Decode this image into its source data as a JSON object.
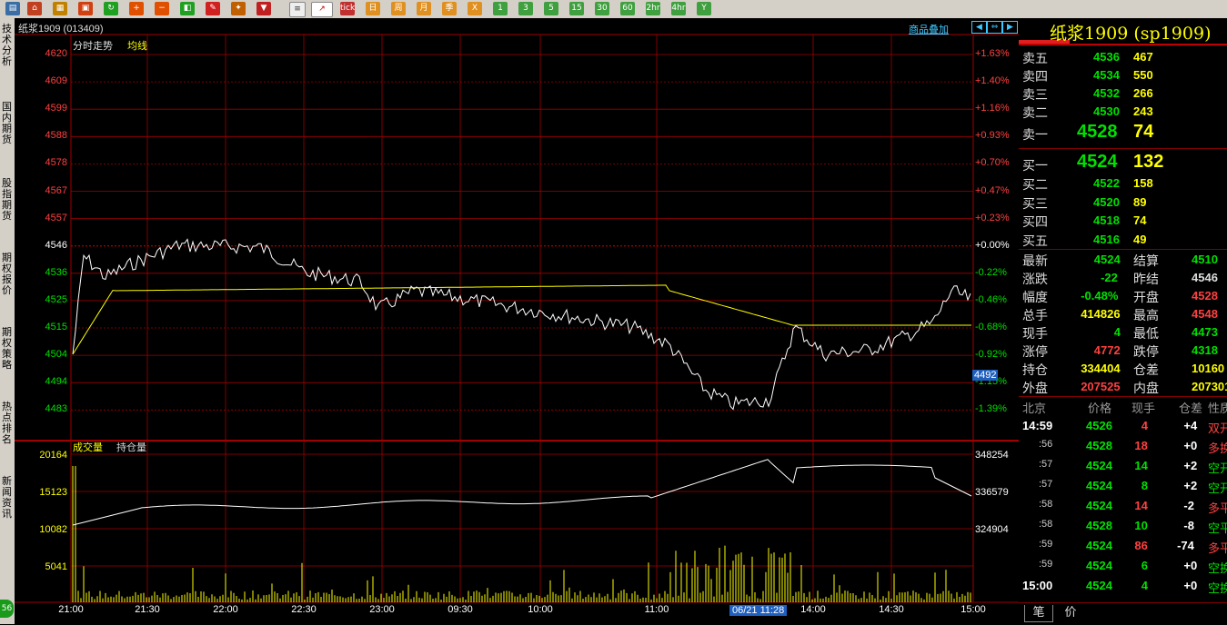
{
  "toolbar": {
    "period_buttons": [
      "tick",
      "日",
      "周",
      "月",
      "季",
      "X",
      "1",
      "3",
      "5",
      "15",
      "30",
      "60",
      "2hr",
      "4hr",
      "Y"
    ]
  },
  "side_tabs": [
    "技术分析",
    "国内期货",
    "股指期货",
    "期权报价",
    "期权策略",
    "热点排名",
    "新闻资讯"
  ],
  "side_bottom": "56",
  "chart": {
    "title": "纸浆1909 (013409)",
    "overlay_button": "商品叠加",
    "legend_price": "分时走势",
    "legend_avg": "均线",
    "price_ticks": [
      "4620",
      "4609",
      "4599",
      "4588",
      "4578",
      "4567",
      "4557",
      "4546",
      "4536",
      "4525",
      "4515",
      "4504",
      "4494",
      "4483"
    ],
    "pct_ticks": [
      "+1.63%",
      "+1.40%",
      "+1.16%",
      "+0.93%",
      "+0.70%",
      "+0.47%",
      "+0.23%",
      "+0.00%",
      "-0.22%",
      "-0.46%",
      "-0.68%",
      "-0.92%",
      "-1.15%",
      "-1.39%"
    ],
    "cursor_price": "4492",
    "volume_title": "成交量",
    "oi_title": "持仓量",
    "vol_ticks": [
      "20164",
      "15123",
      "10082",
      "5041"
    ],
    "oi_ticks": [
      "348254",
      "336579",
      "324904"
    ],
    "time_ticks": [
      "21:00",
      "21:30",
      "22:00",
      "22:30",
      "23:00",
      "09:30",
      "10:00",
      "11:00",
      "14:00",
      "14:30",
      "15:00"
    ],
    "cursor_time": "06/21 11:28",
    "colors": {
      "price_line": "#ffffff",
      "avg_line": "#ffff00",
      "grid": "#a00000",
      "up": "#ff4040",
      "down": "#00e000"
    }
  },
  "quote": {
    "name": "纸浆1909 (sp1909)",
    "sells": [
      {
        "label": "卖五",
        "price": "4536",
        "vol": "467"
      },
      {
        "label": "卖四",
        "price": "4534",
        "vol": "550"
      },
      {
        "label": "卖三",
        "price": "4532",
        "vol": "266"
      },
      {
        "label": "卖二",
        "price": "4530",
        "vol": "243"
      },
      {
        "label": "卖一",
        "price": "4528",
        "vol": "74"
      }
    ],
    "buys": [
      {
        "label": "买一",
        "price": "4524",
        "vol": "132"
      },
      {
        "label": "买二",
        "price": "4522",
        "vol": "158"
      },
      {
        "label": "买三",
        "price": "4520",
        "vol": "89"
      },
      {
        "label": "买四",
        "price": "4518",
        "vol": "74"
      },
      {
        "label": "买五",
        "price": "4516",
        "vol": "49"
      }
    ],
    "stats": [
      {
        "l1": "最新",
        "v1": "4524",
        "l2": "结算",
        "v2": "4510"
      },
      {
        "l1": "涨跌",
        "v1": "-22",
        "l2": "昨结",
        "v2": "4546"
      },
      {
        "l1": "幅度",
        "v1": "-0.48%",
        "l2": "开盘",
        "v2": "4528"
      },
      {
        "l1": "总手",
        "v1": "414826",
        "l2": "最高",
        "v2": "4548"
      },
      {
        "l1": "现手",
        "v1": "4",
        "l2": "最低",
        "v2": "4473"
      },
      {
        "l1": "涨停",
        "v1": "4772",
        "l2": "跌停",
        "v2": "4318"
      },
      {
        "l1": "持仓",
        "v1": "334404",
        "l2": "仓差",
        "v2": "10160"
      },
      {
        "l1": "外盘",
        "v1": "207525",
        "l2": "内盘",
        "v2": "207301"
      }
    ],
    "trade_header": [
      "北京",
      "价格",
      "现手",
      "仓差",
      "性质"
    ],
    "trades": [
      {
        "t": "14:59",
        "p": "4526",
        "v": "4",
        "d": "+4",
        "n": "双开"
      },
      {
        "t": ":56",
        "p": "4528",
        "v": "18",
        "d": "+0",
        "n": "多换"
      },
      {
        "t": ":57",
        "p": "4524",
        "v": "14",
        "d": "+2",
        "n": "空开"
      },
      {
        "t": ":57",
        "p": "4524",
        "v": "8",
        "d": "+2",
        "n": "空开"
      },
      {
        "t": ":58",
        "p": "4524",
        "v": "14",
        "d": "-2",
        "n": "多平"
      },
      {
        "t": ":58",
        "p": "4528",
        "v": "10",
        "d": "-8",
        "n": "空平"
      },
      {
        "t": ":59",
        "p": "4524",
        "v": "86",
        "d": "-74",
        "n": "多平"
      },
      {
        "t": ":59",
        "p": "4524",
        "v": "6",
        "d": "+0",
        "n": "空换"
      },
      {
        "t": "15:00",
        "p": "4524",
        "v": "4",
        "d": "+0",
        "n": "空换"
      }
    ],
    "bottom_tabs": [
      "笔",
      "价"
    ]
  }
}
